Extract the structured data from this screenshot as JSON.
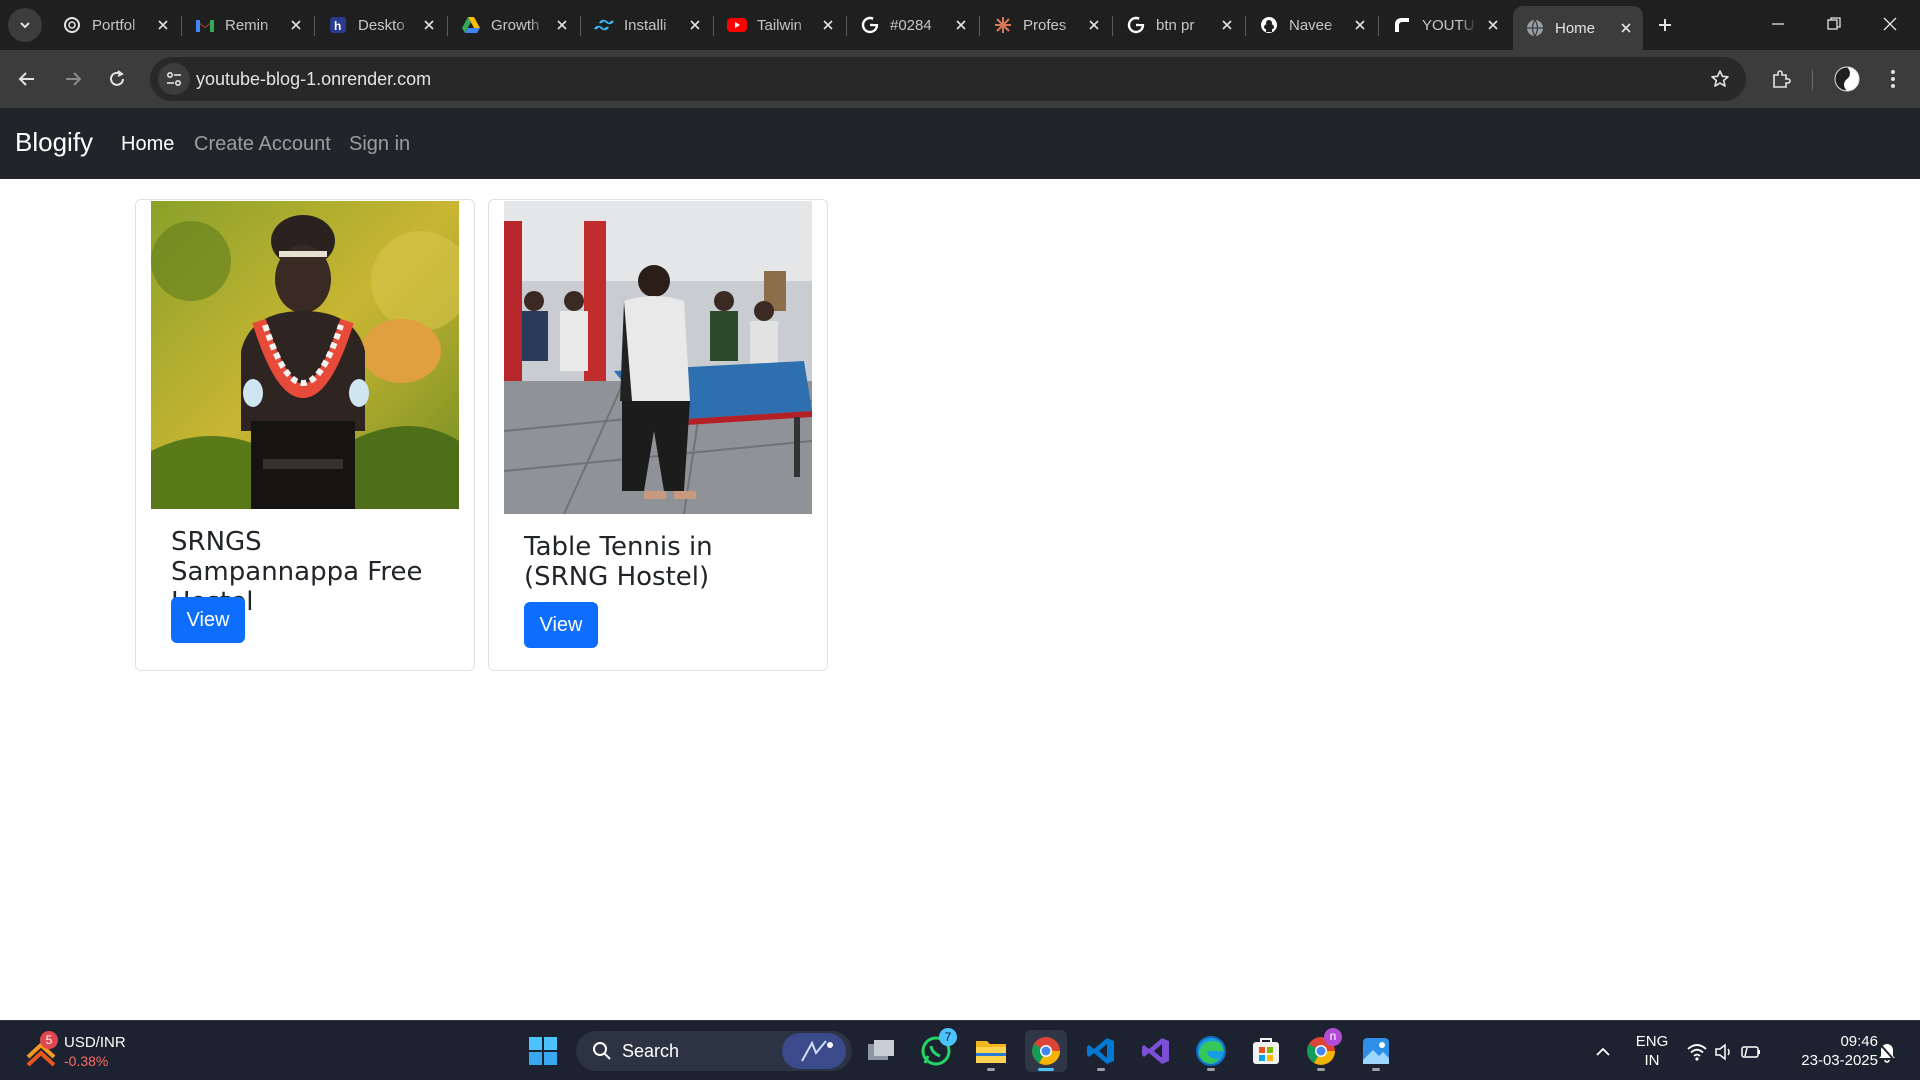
{
  "browser": {
    "tabs": [
      {
        "title": "Portfol",
        "icon": "openai-icon",
        "color": "#e3e3e3"
      },
      {
        "title": "Remin",
        "icon": "gmail-icon",
        "color": "#ea4335"
      },
      {
        "title": "Deskto",
        "icon": "hashnode-icon",
        "color": "#2962ff"
      },
      {
        "title": "Growth",
        "icon": "google-drive-icon",
        "color": "#34a853"
      },
      {
        "title": "Installi",
        "icon": "tailwind-icon",
        "color": "#38bdf8"
      },
      {
        "title": "Tailwin",
        "icon": "youtube-icon",
        "color": "#ff0000"
      },
      {
        "title": "#0284",
        "icon": "google-icon",
        "color": "#ffffff"
      },
      {
        "title": "Profes",
        "icon": "claude-icon",
        "color": "#d97757"
      },
      {
        "title": "btn pr",
        "icon": "google-icon",
        "color": "#ffffff"
      },
      {
        "title": "Navee",
        "icon": "github-icon",
        "color": "#ffffff"
      },
      {
        "title": "YOUTU",
        "icon": "render-icon",
        "color": "#ffffff"
      },
      {
        "title": "Home",
        "icon": "globe-icon",
        "color": "#9aa0a6",
        "active": true
      }
    ],
    "url": "youtube-blog-1.onrender.com"
  },
  "site": {
    "brand": "Blogify",
    "nav": {
      "home": "Home",
      "create_account": "Create Account",
      "sign_in": "Sign in"
    },
    "cards": [
      {
        "title": "SRNGS Sampannappa Free Hostel",
        "button": "View"
      },
      {
        "title": "Table Tennis in (SRNG Hostel)",
        "button": "View"
      }
    ]
  },
  "taskbar": {
    "widget_badge": "5",
    "ticker_name": "USD/INR",
    "ticker_change": "-0.38%",
    "search_label": "Search",
    "whatsapp_badge": "7",
    "chrome_badge": "n",
    "lang_line1": "ENG",
    "lang_line2": "IN",
    "time": "09:46",
    "date": "23-03-2025"
  },
  "colors": {
    "navbar_bg": "#212529",
    "primary": "#0d6efd",
    "ticker_negative": "#ff6b6b"
  }
}
